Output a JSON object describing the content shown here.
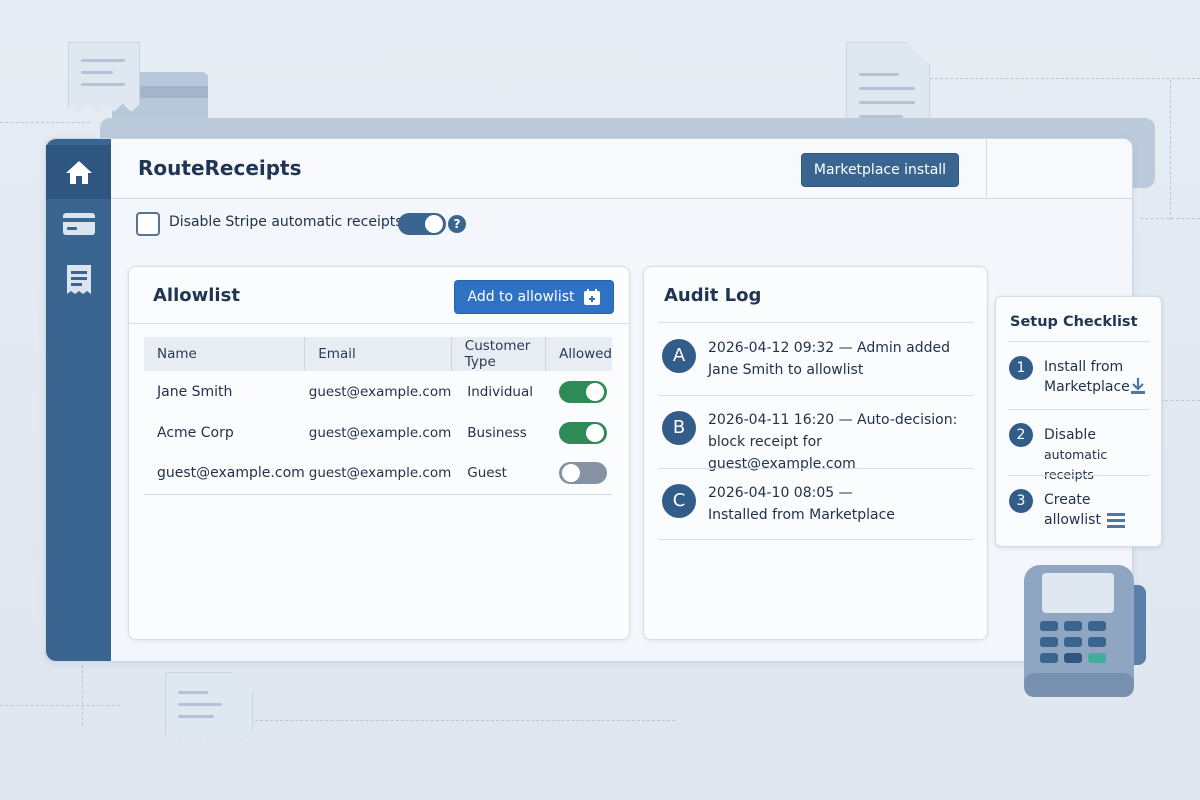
{
  "app": {
    "title": "RouteReceipts",
    "marketplace_button": "Marketplace install"
  },
  "sidebar": {
    "items": [
      {
        "name": "home-icon",
        "active": true
      },
      {
        "name": "credit-card-icon",
        "active": false
      },
      {
        "name": "receipt-icon",
        "active": false
      }
    ]
  },
  "settings": {
    "disable_receipts_label": "Disable Stripe automatic receipts",
    "help_glyph": "?"
  },
  "allowlist": {
    "title": "Allowlist",
    "add_button": "Add to allowlist",
    "columns": [
      "Name",
      "Email",
      "Customer Type",
      "Allowed"
    ],
    "rows": [
      {
        "name": "Jane Smith",
        "email": "guest@example.com",
        "type": "Individual",
        "allowed": true
      },
      {
        "name": "Acme Corp",
        "email": "guest@example.com",
        "type": "Business",
        "allowed": true
      },
      {
        "name": "guest@example.com",
        "email": "guest@example.com",
        "type": "Guest",
        "allowed": false
      }
    ]
  },
  "audit": {
    "title": "Audit Log",
    "entries": [
      {
        "badge": "A",
        "line1": "2026-04-12 09:32 — Admin added",
        "line2": "Jane Smith to allowlist"
      },
      {
        "badge": "B",
        "line1": "2026-04-11 16:20 — Auto-decision:",
        "line2": "block receipt for guest@example.com"
      },
      {
        "badge": "C",
        "line1": "2026-04-10 08:05 —",
        "line2": "Installed from Marketplace"
      }
    ]
  },
  "checklist": {
    "title": "Setup Checklist",
    "steps": [
      {
        "num": "1",
        "line1": "Install from",
        "line2": "Marketplace"
      },
      {
        "num": "2",
        "line1": "Disable",
        "line2": "automatic receipts"
      },
      {
        "num": "3",
        "line1": "Create",
        "line2": "allowlist"
      }
    ]
  },
  "colors": {
    "sidebar": "#3b6591",
    "primary_button": "#2f72c4",
    "toggle_on": "#2e8b57",
    "toggle_off": "#8492a4"
  }
}
